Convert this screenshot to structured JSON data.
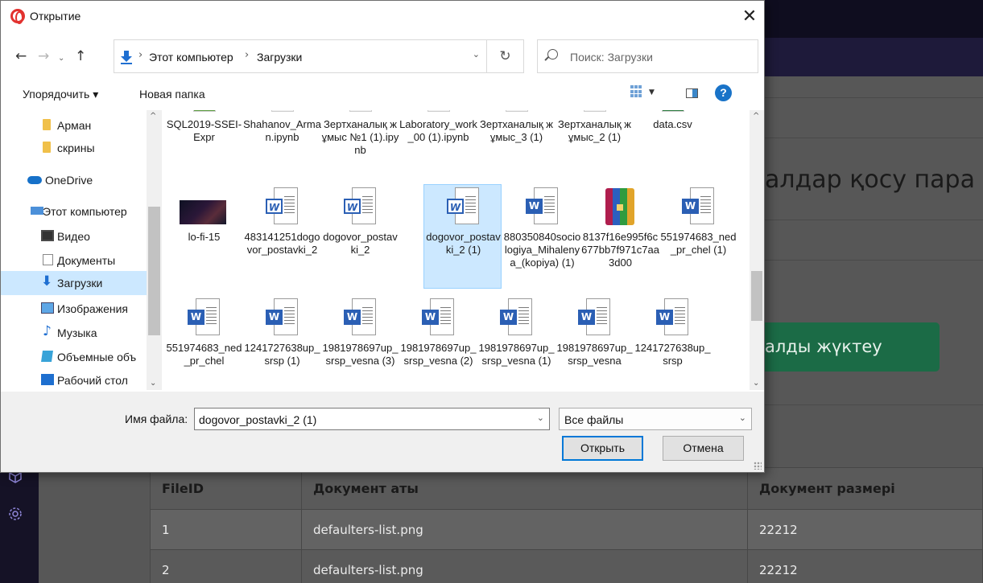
{
  "background": {
    "title": "алдар қосу пара",
    "upload_button": "алды жүктеу",
    "table": {
      "headers": [
        "FileID",
        "Документ аты",
        "Документ размері"
      ],
      "rows": [
        [
          "1",
          "defaulters-list.png",
          "22212"
        ],
        [
          "2",
          "defaulters-list.png",
          "22212"
        ]
      ]
    }
  },
  "dialog": {
    "title": "Открытие",
    "close": "✕",
    "nav": {
      "back": "←",
      "forward": "→",
      "recent": "⌄",
      "up": "↑"
    },
    "address": {
      "crumbs": [
        "Этот компьютер",
        "Загрузки"
      ],
      "separator": "›",
      "dropdown": "⌄"
    },
    "refresh": "↻",
    "search_placeholder": "Поиск: Загрузки",
    "toolbar": {
      "organize": "Упорядочить ▾",
      "new_folder": "Новая папка",
      "view_dropdown": "▼",
      "help": "?"
    },
    "nav_pane": [
      {
        "label": "Арман",
        "icon": "folder-icon"
      },
      {
        "label": "скрины",
        "icon": "folder-icon"
      },
      {
        "label": "OneDrive",
        "icon": "onedrive-icon"
      },
      {
        "label": "Этот компьютер",
        "icon": "computer-icon"
      },
      {
        "label": "Видео",
        "icon": "video-icon"
      },
      {
        "label": "Документы",
        "icon": "documents-icon"
      },
      {
        "label": "Загрузки",
        "icon": "downloads-icon",
        "selected": true
      },
      {
        "label": "Изображения",
        "icon": "images-icon"
      },
      {
        "label": "Музыка",
        "icon": "music-icon"
      },
      {
        "label": "Объемные объ",
        "icon": "3d-objects-icon"
      },
      {
        "label": "Рабочий стол",
        "icon": "desktop-icon"
      }
    ],
    "files_row1": [
      "SQL2019-SSEI-Expr",
      "Shahanov_Arman.ipynb",
      "Зертханалық жұмыс №1 (1).ipynb",
      "Laboratory_work_00 (1).ipynb",
      "Зертханалық жұмыс_3 (1)",
      "Зертханалық жұмыс_2 (1)",
      "data.csv"
    ],
    "files_row2": [
      {
        "name": "lo-fi-15",
        "icon": "image"
      },
      {
        "name": "483141251dogovor_postavki_2",
        "icon": "word-old"
      },
      {
        "name": "dogovor_postavki_2",
        "icon": "word-old"
      },
      {
        "name": "dogovor_postavki_2 (1)",
        "icon": "word-old",
        "selected": true
      },
      {
        "name": "880350840sociologiya_Mihalenya_(kopiya) (1)",
        "icon": "word"
      },
      {
        "name": "8137f16e995f6c677bb7f971c7aa3d00",
        "icon": "rar"
      },
      {
        "name": "551974683_ned_pr_chel (1)",
        "icon": "word"
      }
    ],
    "files_row3": [
      "551974683_ned_pr_chel",
      "1241727638up_srsp (1)",
      "1981978697up_srsp_vesna (3)",
      "1981978697up_srsp_vesna (2)",
      "1981978697up_srsp_vesna (1)",
      "1981978697up_srsp_vesna",
      "1241727638up_srsp"
    ],
    "filename_label": "Имя файла:",
    "filename_value": "dogovor_postavki_2 (1)",
    "filter_value": "Все файлы",
    "open_button": "Открыть",
    "cancel_button": "Отмена"
  }
}
